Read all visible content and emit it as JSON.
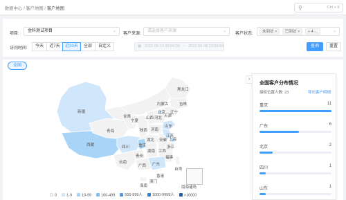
{
  "breadcrumb": {
    "part1": "数据中心",
    "part2": "客户地图",
    "part3": "客户地图",
    "sep": "/"
  },
  "search": {
    "shortcut": "Ctrl + K"
  },
  "filters": {
    "project_label": "项目:",
    "project_value": "金科测试项目",
    "source_label": "客户来源:",
    "source_placeholder": "请选择客户来源",
    "status_label": "客户状态:",
    "status_tags": [
      "未到访 ×",
      "已到访 ×",
      "+ 4 ..."
    ],
    "visit_time_label": "访问时间:",
    "segments": [
      "今天",
      "近7天",
      "近30天",
      "全部",
      "自定义"
    ],
    "active_segment": "近30天",
    "date_start": "2022-05-10 00:00:00",
    "date_sep": "~",
    "date_end": "2022-06-08 23:59:59",
    "query_button": "查询",
    "reset_button": "重置"
  },
  "map": {
    "national_button": "全国",
    "provinces": [
      {
        "name": "新疆",
        "level": "1-9"
      },
      {
        "name": "西藏",
        "level": "10-99"
      },
      {
        "name": "青海",
        "level": "0"
      },
      {
        "name": "甘肃",
        "level": "0"
      },
      {
        "name": "内蒙古",
        "level": "0"
      },
      {
        "name": "宁夏",
        "level": "0"
      },
      {
        "name": "陕西",
        "level": "0"
      },
      {
        "name": "山西",
        "level": "0"
      },
      {
        "name": "河北",
        "level": "0"
      },
      {
        "name": "北京",
        "level": "1-9"
      },
      {
        "name": "天津",
        "level": "0"
      },
      {
        "name": "辽宁",
        "level": "0"
      },
      {
        "name": "吉林",
        "level": "0"
      },
      {
        "name": "黑龙江",
        "level": "0"
      },
      {
        "name": "山东",
        "level": "1-9"
      },
      {
        "name": "河南",
        "level": "0"
      },
      {
        "name": "江苏",
        "level": "1-9"
      },
      {
        "name": "安徽",
        "level": "0"
      },
      {
        "name": "湖北",
        "level": "0"
      },
      {
        "name": "四川",
        "level": "1-9"
      },
      {
        "name": "重庆",
        "level": "10-99"
      },
      {
        "name": "贵州",
        "level": "0"
      },
      {
        "name": "云南",
        "level": "0"
      },
      {
        "name": "湖南",
        "level": "0"
      },
      {
        "name": "江西",
        "level": "0"
      },
      {
        "name": "浙江",
        "level": "0"
      },
      {
        "name": "上海",
        "level": "10-99"
      },
      {
        "name": "福建",
        "level": "0"
      },
      {
        "name": "广西",
        "level": "0"
      },
      {
        "name": "广东",
        "level": "1-9"
      },
      {
        "name": "台湾",
        "level": "0"
      },
      {
        "name": "海南",
        "level": "0"
      },
      {
        "name": "香港",
        "level": "0"
      },
      {
        "name": "澳门",
        "level": "0"
      }
    ],
    "inset_label": "南海诸岛",
    "legend": [
      {
        "label": "0",
        "color": "#f2f2f2"
      },
      {
        "label": "1-9",
        "color": "#cfe6fb"
      },
      {
        "label": "10-99",
        "color": "#a8d4f7"
      },
      {
        "label": "100-499",
        "color": "#7fbdf2"
      },
      {
        "label": "500-999人",
        "color": "#4e9de6"
      },
      {
        "label": "1000-9999人",
        "color": "#2e7fd6"
      },
      {
        "label": ">10000",
        "color": "#1a5fb4"
      }
    ]
  },
  "panel": {
    "title": "全国客户分布情况",
    "auth_label": "授权位置人数:",
    "auth_count": "23",
    "export_link": "导出客户明细",
    "rows": [
      {
        "name": "重庆",
        "count": "11",
        "fraction": 1.0
      },
      {
        "name": "广东",
        "count": "6",
        "fraction": 0.55
      },
      {
        "name": "北京",
        "count": "2",
        "fraction": 0.18
      },
      {
        "name": "四川",
        "count": "1",
        "fraction": 0.09
      },
      {
        "name": "山东",
        "count": "1",
        "fraction": 0.09
      }
    ],
    "colors": {
      "bar": "#409eff",
      "track": "#ebeef5"
    }
  },
  "colors": {
    "accent": "#409eff",
    "border": "#ffffff"
  }
}
